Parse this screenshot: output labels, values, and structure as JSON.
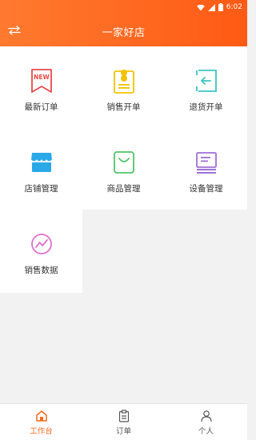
{
  "status_bar": {
    "time": "6:02"
  },
  "header": {
    "title": "一家好店"
  },
  "grid": [
    {
      "label": "最新订单",
      "icon": "new-order-icon",
      "badge": "NEW",
      "color": "#e84a4a"
    },
    {
      "label": "销售开单",
      "icon": "sales-order-icon",
      "color": "#f2c200"
    },
    {
      "label": "退货开单",
      "icon": "return-order-icon",
      "color": "#3cc4c4"
    },
    {
      "label": "店铺管理",
      "icon": "store-icon",
      "color": "#2aa8e8"
    },
    {
      "label": "商品管理",
      "icon": "shopping-bag-icon",
      "color": "#52c46a"
    },
    {
      "label": "设备管理",
      "icon": "device-icon",
      "color": "#a070d8"
    },
    {
      "label": "销售数据",
      "icon": "sales-chart-icon",
      "color": "#e070d0"
    }
  ],
  "tabbar": [
    {
      "label": "工作台",
      "icon": "home-icon",
      "active": true
    },
    {
      "label": "订单",
      "icon": "clipboard-icon",
      "active": false
    },
    {
      "label": "个人",
      "icon": "user-icon",
      "active": false
    }
  ],
  "colors": {
    "accent": "#ff6a1a",
    "header_start": "#ff7a2f",
    "header_end": "#ff5a14"
  }
}
